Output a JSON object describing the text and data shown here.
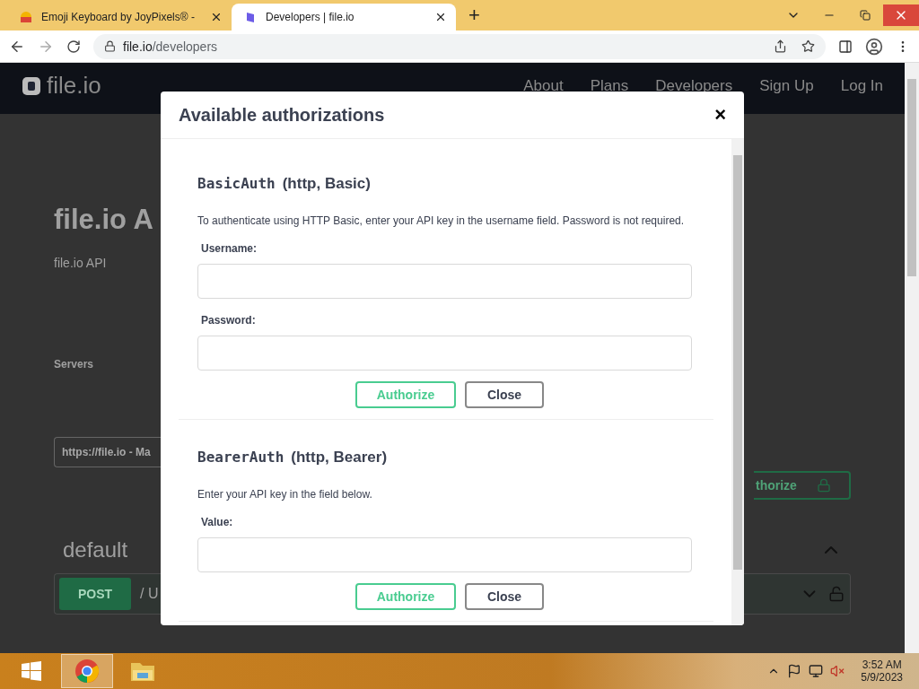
{
  "browser": {
    "tabs": [
      {
        "title": "Emoji Keyboard by JoyPixels® -",
        "selected": false
      },
      {
        "title": "Developers | file.io",
        "selected": true
      }
    ],
    "new_tab": "+",
    "url_host": "file.io",
    "url_path": "/developers"
  },
  "site": {
    "logo": "file.io",
    "nav": [
      {
        "label": "About"
      },
      {
        "label": "Plans"
      },
      {
        "label": "Developers"
      },
      {
        "label": "Sign Up"
      },
      {
        "label": "Log In"
      }
    ],
    "title": "file.io A",
    "subtitle": "file.io API",
    "servers_label": "Servers",
    "server": "https://file.io - Ma",
    "authorize": "thorize",
    "section": {
      "title": "default",
      "expanded": true
    },
    "operations": [
      {
        "method": "POST",
        "path": "/ U",
        "color": "#1f6b45"
      }
    ]
  },
  "dialog": {
    "title": "Available authorizations",
    "close": "×",
    "schemes": [
      {
        "name": "BasicAuth",
        "type": "(http, Basic)",
        "description": "To authenticate using HTTP Basic, enter your API key in the username field. Password is not required.",
        "fields": [
          {
            "label": "Username:"
          },
          {
            "label": "Password:"
          }
        ],
        "buttons": [
          "Authorize",
          "Close"
        ]
      },
      {
        "name": "BearerAuth",
        "type": "(http, Bearer)",
        "description": "Enter your API key in the field below.",
        "fields": [
          {
            "label": "Value:"
          }
        ],
        "buttons": [
          "Authorize",
          "Close"
        ]
      }
    ]
  },
  "taskbar": {
    "time": "3:52 AM",
    "date": "5/9/2023"
  }
}
